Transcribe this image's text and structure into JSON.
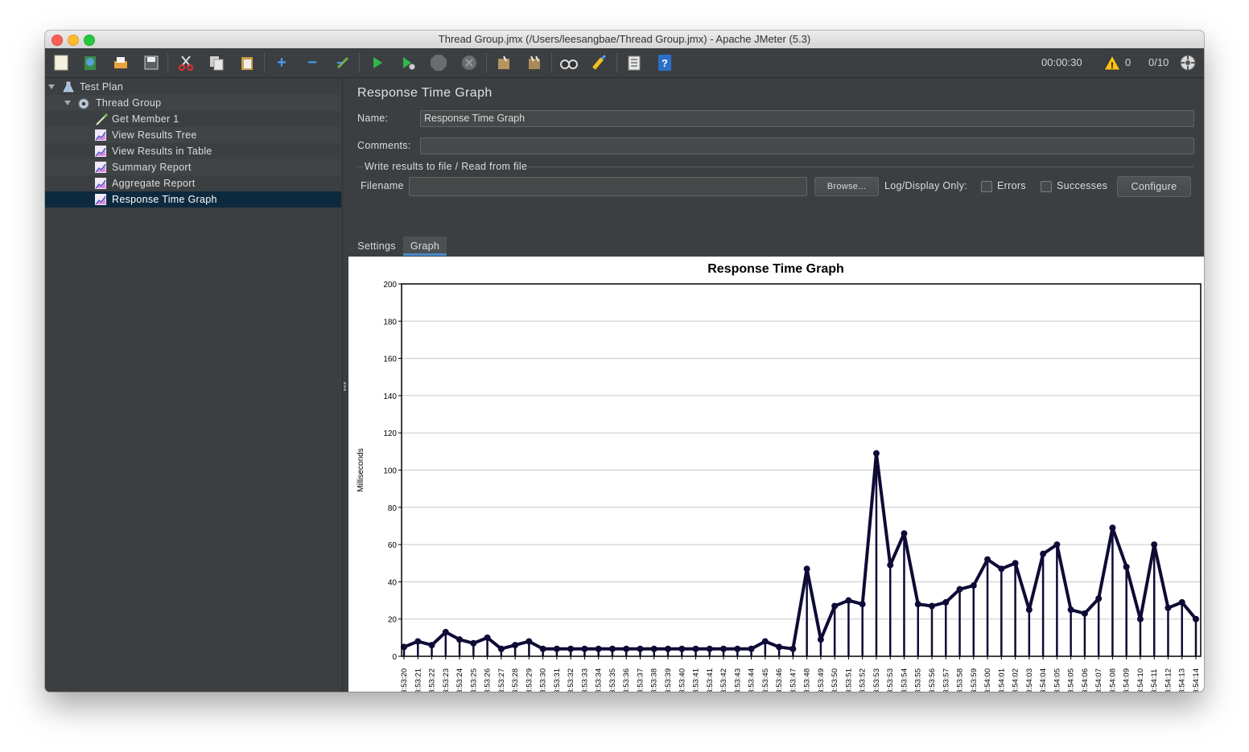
{
  "window": {
    "title": "Thread Group.jmx (/Users/leesangbae/Thread Group.jmx) - Apache JMeter (5.3)"
  },
  "toolbar": {
    "elapsed_time": "00:00:30",
    "warnings_count": "0",
    "threads": "0/10",
    "buttons": [
      "new-icon",
      "templates-icon",
      "open-icon",
      "save-icon",
      "cut-icon",
      "copy-icon",
      "paste-icon",
      "expand-icon",
      "collapse-icon",
      "toggle-icon",
      "start-icon",
      "start-no-pauses-icon",
      "stop-icon",
      "shutdown-icon",
      "clear-icon",
      "clear-all-icon",
      "search-icon",
      "reset-search-icon",
      "function-helper-icon",
      "help-icon"
    ]
  },
  "tree": {
    "items": [
      {
        "label": "Test Plan",
        "icon": "flask-icon",
        "level": 0
      },
      {
        "label": "Thread Group",
        "icon": "gear-icon",
        "level": 1
      },
      {
        "label": "Get Member 1",
        "icon": "pipette-icon",
        "level": 2
      },
      {
        "label": "View Results Tree",
        "icon": "graph-icon",
        "level": 2
      },
      {
        "label": "View Results in Table",
        "icon": "graph-icon",
        "level": 2
      },
      {
        "label": "Summary Report",
        "icon": "graph-icon",
        "level": 2
      },
      {
        "label": "Aggregate Report",
        "icon": "graph-icon",
        "level": 2
      },
      {
        "label": "Response Time Graph",
        "icon": "graph-icon",
        "level": 2,
        "selected": true
      }
    ]
  },
  "panel": {
    "title": "Response Time Graph",
    "name_label": "Name:",
    "name_value": "Response Time Graph",
    "comments_label": "Comments:",
    "comments_value": "",
    "file_group_title": "Write results to file / Read from file",
    "filename_label": "Filename",
    "filename_value": "",
    "browse_label": "Browse...",
    "log_display_label": "Log/Display Only:",
    "errors_label": "Errors",
    "successes_label": "Successes",
    "configure_label": "Configure",
    "tabs": [
      "Settings",
      "Graph"
    ],
    "active_tab": "Graph"
  },
  "chart_data": {
    "type": "line",
    "title": "Response Time Graph",
    "ylabel": "Milliseconds",
    "xlabel": "",
    "ylim": [
      0,
      200
    ],
    "yticks": [
      0,
      20,
      40,
      60,
      80,
      100,
      120,
      140,
      160,
      180,
      200
    ],
    "grid": true,
    "legend_position": "bottom",
    "categories": [
      "23:53:20",
      "23:53:21",
      "23:53:22",
      "23:53:23",
      "23:53:24",
      "23:53:25",
      "23:53:26",
      "23:53:27",
      "23:53:28",
      "23:53:29",
      "23:53:30",
      "23:53:31",
      "23:53:32",
      "23:53:33",
      "23:53:34",
      "23:53:35",
      "23:53:36",
      "23:53:37",
      "23:53:38",
      "23:53:39",
      "23:53:40",
      "23:53:41",
      "23:53:41",
      "23:53:42",
      "23:53:43",
      "23:53:44",
      "23:53:45",
      "23:53:46",
      "23:53:47",
      "23:53:48",
      "23:53:49",
      "23:53:50",
      "23:53:51",
      "23:53:52",
      "23:53:53",
      "23:53:53",
      "23:53:54",
      "23:53:55",
      "23:53:56",
      "23:53:57",
      "23:53:58",
      "23:53:59",
      "23:54:00",
      "23:54:01",
      "23:54:02",
      "23:54:03",
      "23:54:04",
      "23:54:05",
      "23:54:05",
      "23:54:06",
      "23:54:07",
      "23:54:08",
      "23:54:09",
      "23:54:10",
      "23:54:11",
      "23:54:12",
      "23:54:13",
      "23:54:14"
    ],
    "series": [
      {
        "name": "Get Member 1",
        "color": "#0e0b36",
        "values": [
          5,
          8,
          6,
          13,
          9,
          7,
          10,
          4,
          6,
          8,
          4,
          4,
          4,
          4,
          4,
          4,
          4,
          4,
          4,
          4,
          4,
          4,
          4,
          4,
          4,
          4,
          8,
          5,
          4,
          47,
          9,
          27,
          30,
          28,
          109,
          49,
          66,
          28,
          27,
          29,
          36,
          38,
          52,
          47,
          50,
          25,
          55,
          60,
          25,
          23,
          31,
          69,
          48,
          20,
          60,
          26,
          29,
          20
        ]
      }
    ]
  }
}
